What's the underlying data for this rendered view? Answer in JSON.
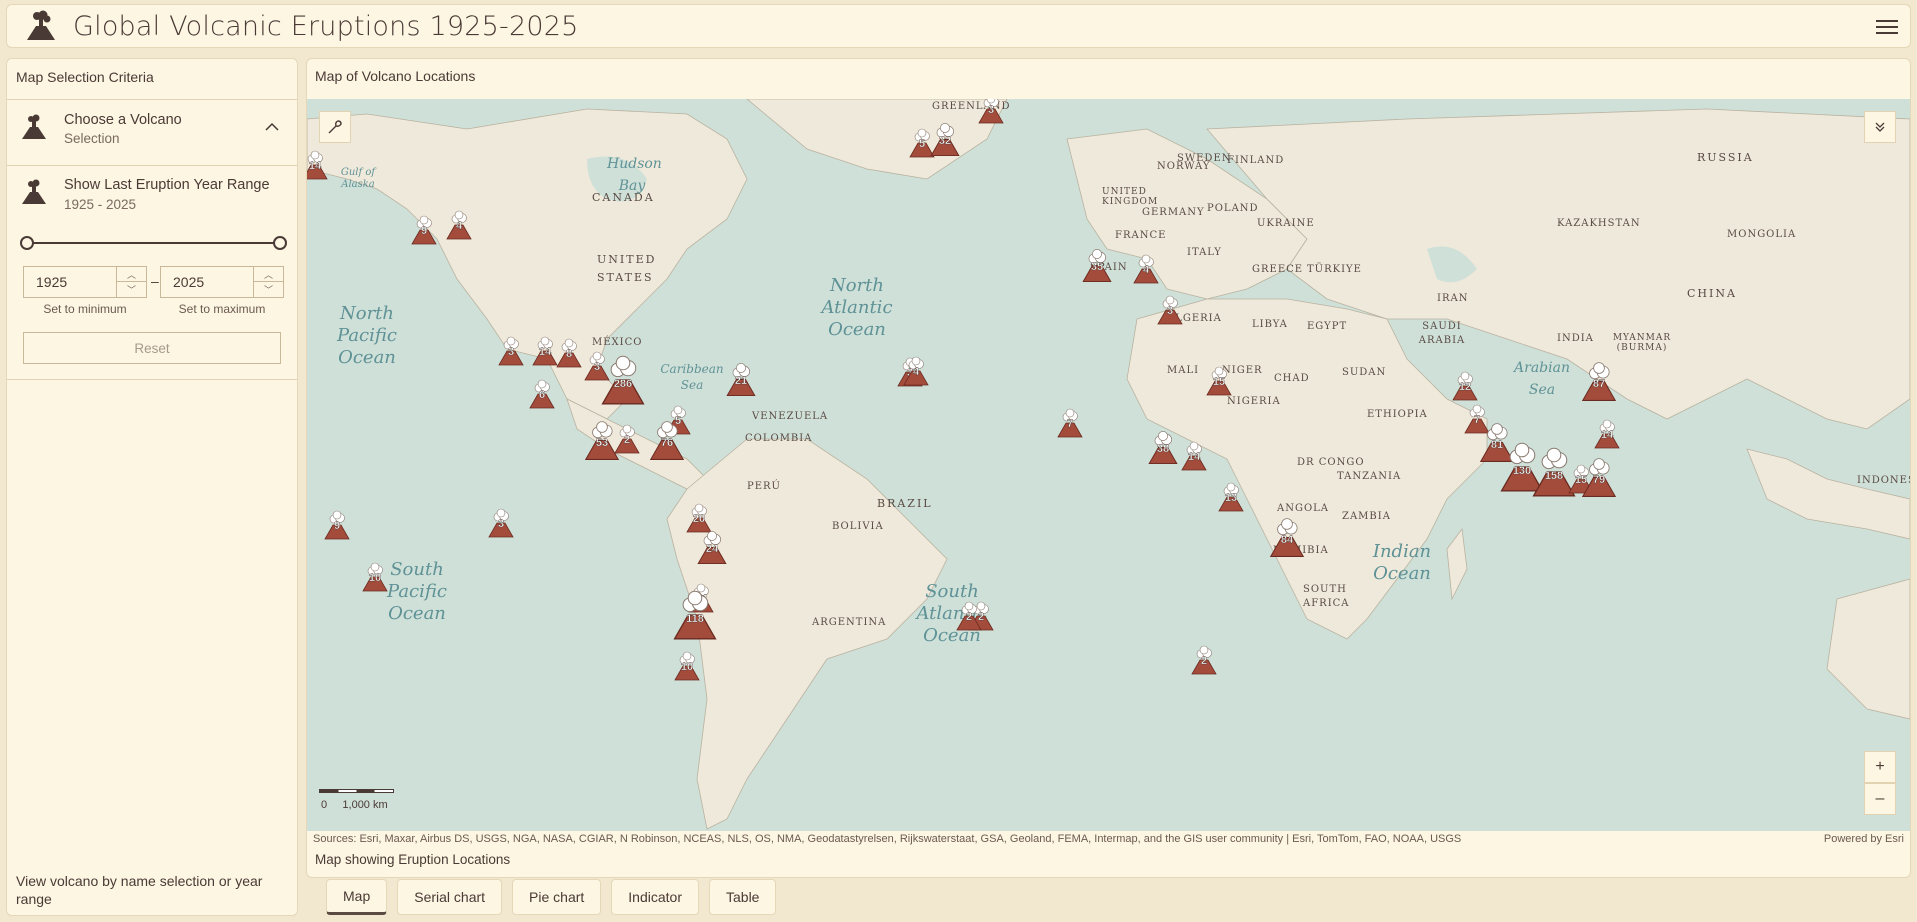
{
  "app": {
    "title": "Global Volcanic Eruptions 1925-2025",
    "logo_icon": "volcano-icon",
    "menu_icon": "hamburger-icon"
  },
  "left_panel": {
    "title": "Map Selection Criteria",
    "volcano_section": {
      "title": "Choose a Volcano",
      "subtitle": "Selection"
    },
    "year_section": {
      "title": "Show Last Eruption Year Range",
      "subtitle": "1925 - 2025"
    },
    "min_value": "1925",
    "max_value": "2025",
    "range_separator": "–",
    "set_min_label": "Set to minimum",
    "set_max_label": "Set to maximum",
    "reset_label": "Reset",
    "footer": "View volcano by name selection or year range"
  },
  "map": {
    "title": "Map of Volcano Locations",
    "attribution": "Sources: Esri, Maxar, Airbus DS, USGS, NGA, NASA, CGIAR, N Robinson, NCEAS, NLS, OS, NMA, Geodatastyrelsen, Rijkswaterstaat, GSA, Geoland, FEMA, Intermap, and the GIS user community | Esri, TomTom, FAO, NOAA, USGS",
    "powered_by": "Powered by Esri",
    "caption": "Map showing Eruption Locations",
    "scale_label": "0     1,000 km",
    "zoom_in": "+",
    "zoom_out": "–",
    "places": [
      "GREENLAND",
      "CANADA",
      "UNITED STATES",
      "MÉXICO",
      "VENEZUELA",
      "COLOMBIA",
      "PERÚ",
      "BRAZIL",
      "BOLIVIA",
      "ARGENTINA",
      "SWEDEN",
      "FINLAND",
      "NORWAY",
      "UNITED KINGDOM",
      "GERMANY",
      "POLAND",
      "UKRAINE",
      "FRANCE",
      "SPAIN",
      "ITALY",
      "GREECE",
      "TÜRKIYE",
      "RUSSIA",
      "KAZAKHSTAN",
      "MONGOLIA",
      "CHINA",
      "IRAN",
      "SAUDI ARABIA",
      "INDIA",
      "MYANMAR (BURMA)",
      "ALGERIA",
      "LIBYA",
      "EGYPT",
      "MALI",
      "NIGER",
      "CHAD",
      "SUDAN",
      "NIGERIA",
      "ETHIOPIA",
      "DR CONGO",
      "TANZANIA",
      "ANGOLA",
      "ZAMBIA",
      "NAMIBIA",
      "SOUTH AFRICA",
      "INDONESIA"
    ],
    "oceans": [
      "North Pacific Ocean",
      "North Atlantic Ocean",
      "South Pacific Ocean",
      "South Atlantic Ocean",
      "Indian Ocean",
      "Arabian Sea",
      "Caribbean Sea",
      "Hudson Bay",
      "Gulf of Alaska"
    ],
    "markers": [
      "14",
      "9",
      "4",
      "3",
      "14",
      "8",
      "3",
      "286",
      "6",
      "5",
      "2",
      "53",
      "76",
      "3",
      "21",
      "2",
      "5",
      "32",
      "3",
      "35",
      "4",
      "3",
      "4",
      "20",
      "24",
      "14",
      "118",
      "10",
      "9",
      "3",
      "10",
      "2",
      "7",
      "38",
      "14",
      "15",
      "13",
      "84",
      "2",
      "12",
      "7",
      "81",
      "130",
      "158",
      "15",
      "79",
      "87",
      "14"
    ]
  }
}
